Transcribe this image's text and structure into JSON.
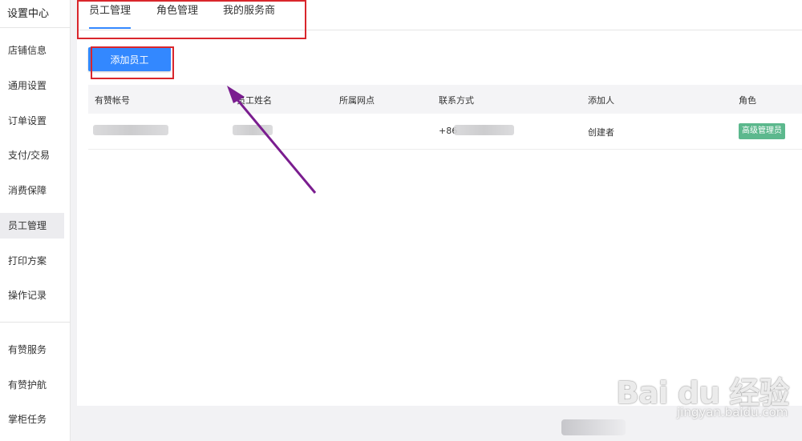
{
  "sidebar": {
    "title": "设置中心",
    "items": [
      {
        "label": "店铺信息"
      },
      {
        "label": "通用设置"
      },
      {
        "label": "订单设置"
      },
      {
        "label": "支付/交易"
      },
      {
        "label": "消费保障"
      },
      {
        "label": "员工管理",
        "active": true
      },
      {
        "label": "打印方案"
      },
      {
        "label": "操作记录"
      },
      {
        "label": "有赞服务"
      },
      {
        "label": "有赞护航"
      },
      {
        "label": "掌柜任务"
      }
    ]
  },
  "tabs": [
    {
      "label": "员工管理",
      "active": true
    },
    {
      "label": "角色管理"
    },
    {
      "label": "我的服务商"
    }
  ],
  "toolbar": {
    "add_label": "添加员工"
  },
  "table": {
    "headers": [
      "有赞帐号",
      "员工姓名",
      "所属网点",
      "联系方式",
      "添加人",
      "角色"
    ],
    "rows": [
      {
        "contact_prefix": "+86",
        "added_by": "创建者",
        "role": "高级管理员"
      }
    ]
  },
  "colors": {
    "accent": "#3388ff",
    "badge": "#5cb88d",
    "annotation_box": "#d9262c",
    "annotation_arrow": "#7a1d8f"
  },
  "watermark": {
    "brand": "Bai du 经验",
    "url": "jingyan.baidu.com"
  }
}
